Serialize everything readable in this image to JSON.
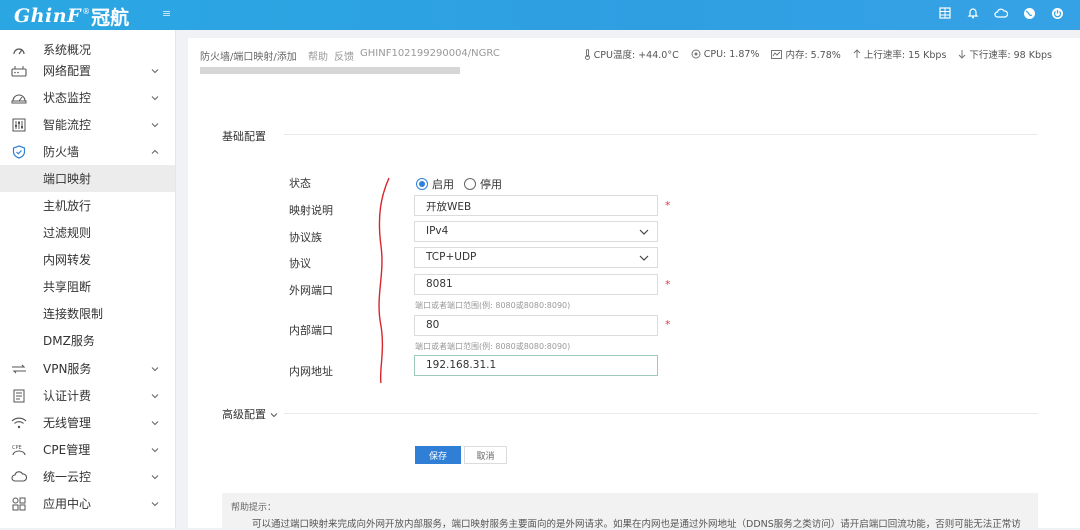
{
  "header": {
    "logo_latin": "GhinF",
    "logo_reg": "®",
    "logo_cn": "冠航",
    "menu_toggle_glyph": "≡",
    "icons": [
      "grid-icon",
      "bell-icon",
      "cloud-icon",
      "globe-icon",
      "power-icon"
    ]
  },
  "sidebar": {
    "items": [
      {
        "label": "系统概况",
        "icon": "dashboard-icon",
        "expandable": false
      },
      {
        "label": "网络配置",
        "icon": "router-icon",
        "expandable": true
      },
      {
        "label": "状态监控",
        "icon": "gauge-icon",
        "expandable": true
      },
      {
        "label": "智能流控",
        "icon": "sliders-icon",
        "expandable": true
      },
      {
        "label": "防火墙",
        "icon": "shield-icon",
        "expandable": true,
        "expanded": true
      }
    ],
    "firewall_sub": [
      {
        "label": "端口映射",
        "active": true
      },
      {
        "label": "主机放行",
        "active": false
      },
      {
        "label": "过滤规则",
        "active": false
      },
      {
        "label": "内网转发",
        "active": false
      },
      {
        "label": "共享阻断",
        "active": false
      },
      {
        "label": "连接数限制",
        "active": false
      },
      {
        "label": "DMZ服务",
        "active": false
      }
    ],
    "items_after": [
      {
        "label": "VPN服务",
        "icon": "vpn-icon"
      },
      {
        "label": "认证计费",
        "icon": "receipt-icon"
      },
      {
        "label": "无线管理",
        "icon": "wifi-icon"
      },
      {
        "label": "CPE管理",
        "icon": "cpe-icon"
      },
      {
        "label": "统一云控",
        "icon": "cloud-icon"
      },
      {
        "label": "应用中心",
        "icon": "apps-icon"
      }
    ]
  },
  "breadcrumb": {
    "path": "防火墙/端口映射/添加",
    "help": "帮助",
    "feedback": "反馈",
    "device": "GHINF102199290004/NGRC"
  },
  "status": {
    "cpu_temp": "CPU温度: +44.0°C",
    "cpu": "CPU: 1.87%",
    "memory": "内存: 5.78%",
    "upload": "上行速率: 15 Kbps",
    "download": "下行速率: 98 Kbps"
  },
  "sections": {
    "basic": "基础配置",
    "advanced": "高级配置"
  },
  "form": {
    "status_label": "状态",
    "status_enable": "启用",
    "status_disable": "停用",
    "desc_label": "映射说明",
    "desc_value": "开放WEB",
    "family_label": "协议族",
    "family_value": "IPv4",
    "protocol_label": "协议",
    "protocol_value": "TCP+UDP",
    "ext_port_label": "外网端口",
    "ext_port_value": "8081",
    "ext_port_hint": "端口或者端口范围(例: 8080或8080:8090)",
    "int_port_label": "内部端口",
    "int_port_value": "80",
    "int_port_hint": "端口或者端口范围(例: 8080或8080:8090)",
    "ip_label": "内网地址",
    "ip_value": "192.168.31.1",
    "required_mark": "*"
  },
  "buttons": {
    "save": "保存",
    "cancel": "取消"
  },
  "help": {
    "title": "帮助提示：",
    "text": "可以通过端口映射来完成向外网开放内部服务，端口映射服务主要面向的是外网请求。如果在内网也是通过外网地址（DDNS服务之类访问）请开启端口回流功能，否则可能无法正常访"
  },
  "colors": {
    "topbar": "#2ea3e4",
    "accent": "#2f7fd6",
    "required": "#e4393c",
    "annotation": "#d9262c"
  }
}
